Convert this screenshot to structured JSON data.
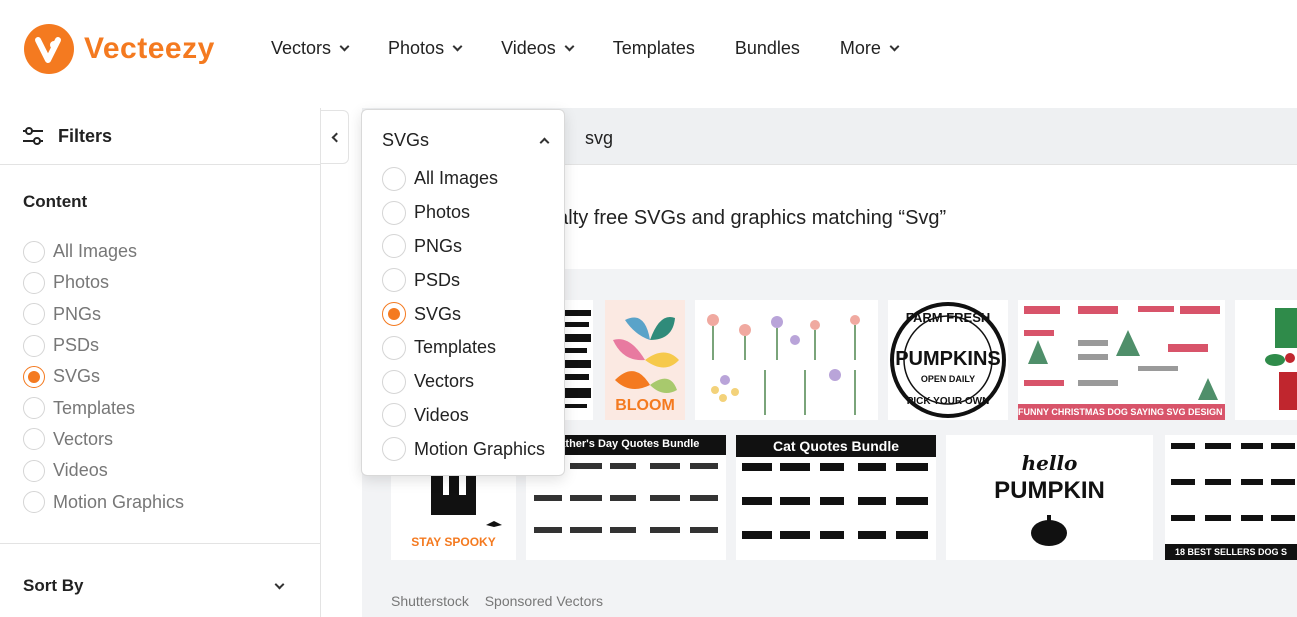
{
  "brand": {
    "name": "Vecteezy",
    "color": "#f47a20"
  },
  "nav": [
    {
      "label": "Vectors",
      "dropdown": true
    },
    {
      "label": "Photos",
      "dropdown": true
    },
    {
      "label": "Videos",
      "dropdown": true
    },
    {
      "label": "Templates",
      "dropdown": false
    },
    {
      "label": "Bundles",
      "dropdown": false
    },
    {
      "label": "More",
      "dropdown": true
    }
  ],
  "sidebar": {
    "filters_label": "Filters",
    "content_title": "Content",
    "options": [
      "All Images",
      "Photos",
      "PNGs",
      "PSDs",
      "SVGs",
      "Templates",
      "Vectors",
      "Videos",
      "Motion Graphics"
    ],
    "selected": "SVGs",
    "sort_label": "Sort By"
  },
  "search": {
    "query": "svg"
  },
  "results": {
    "heading_partial": "oyalty free SVGs and graphics matching “Svg”"
  },
  "dropdown": {
    "selected_label": "SVGs",
    "options": [
      "All Images",
      "Photos",
      "PNGs",
      "PSDs",
      "SVGs",
      "Templates",
      "Vectors",
      "Videos",
      "Motion Graphics"
    ]
  },
  "tiles": {
    "christmas_caption": "FUNNY CHRISTMAS DOG SAYING SVG DESIGN BUNDLE",
    "fathers_day_title": "Father's Day Quotes Bundle",
    "cat_quotes_title": "Cat Quotes Bundle",
    "dog_caption": "18 BEST SELLERS DOG S",
    "pumpkins_top": "FARM FRESH",
    "pumpkins_main": "PUMPKINS",
    "pumpkins_sub": "OPEN DAILY",
    "pumpkins_bottom": "PICK YOUR OWN",
    "hello_script": "hello",
    "hello_main": "PUMPKIN",
    "bloom": "BLOOM",
    "spooky": "STAY SPOOKY"
  },
  "sponsored": {
    "source": "Shutterstock",
    "label": "Sponsored Vectors"
  }
}
